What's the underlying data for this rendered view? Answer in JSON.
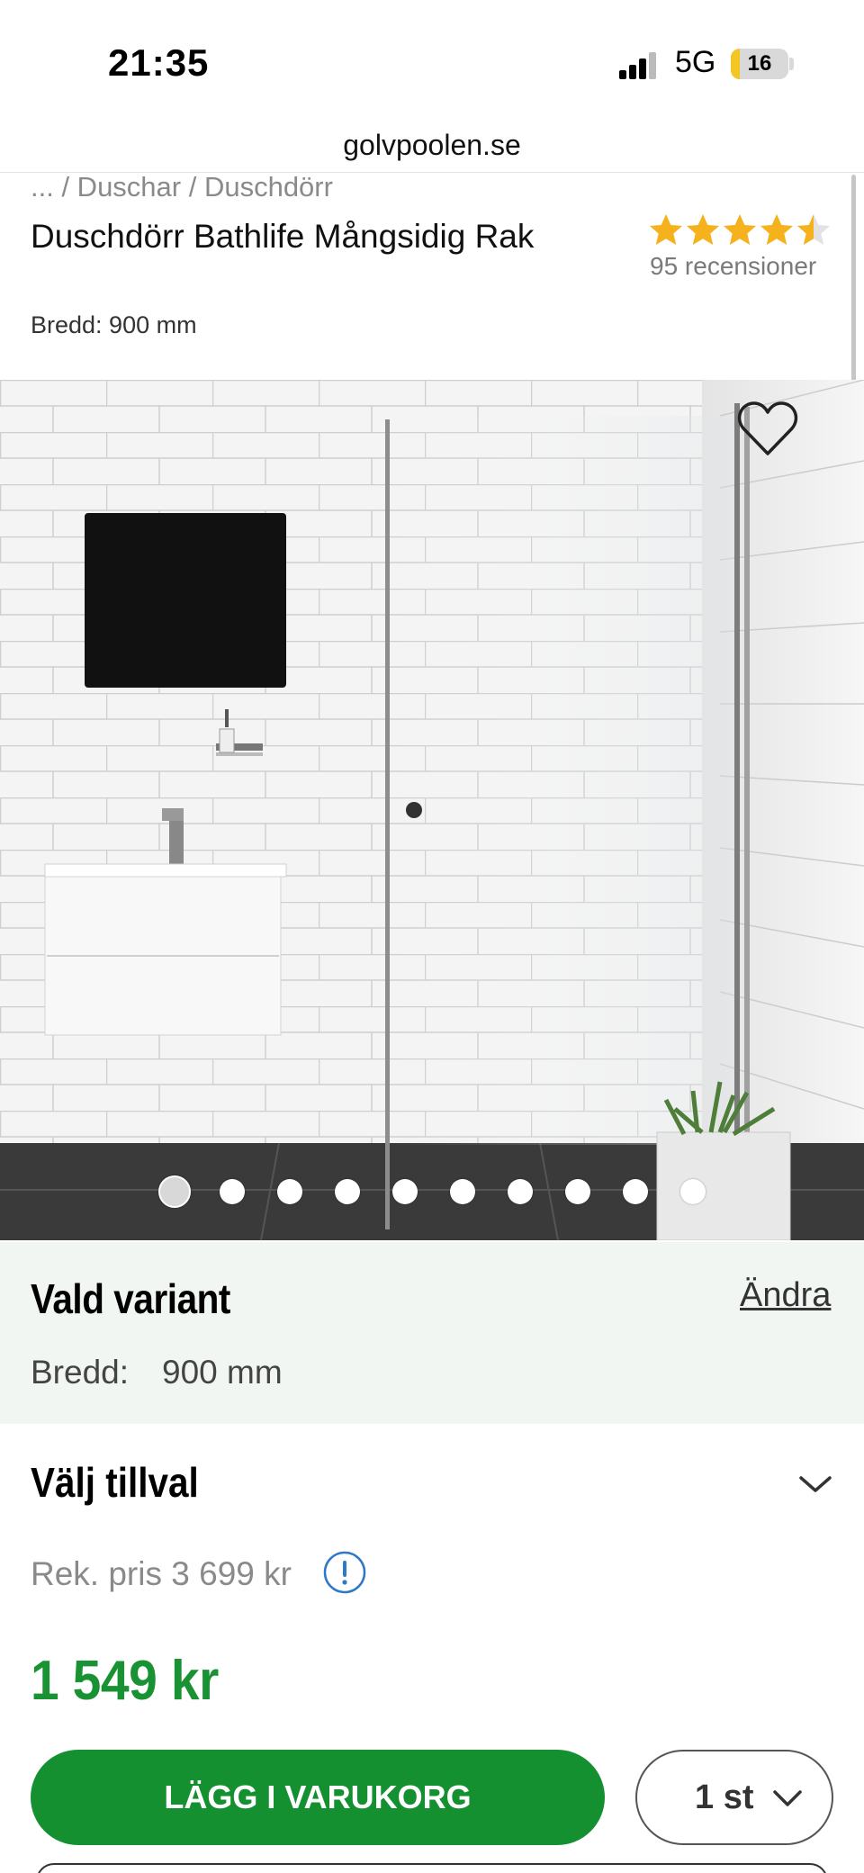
{
  "status_bar": {
    "time": "21:35",
    "network": "5G",
    "battery": "16",
    "battery_percent": 16
  },
  "browser": {
    "url": "golvpoolen.se"
  },
  "breadcrumb": "... / Duschar / Duschdörr",
  "product": {
    "title": "Duschdörr Bathlife Mångsidig Rak",
    "subtitle": "Bredd: 900 mm",
    "rating": 4.5,
    "rating_max": 5,
    "reviews": "95 recensioner",
    "image_count": 10,
    "active_image": 1
  },
  "variant": {
    "title": "Vald variant",
    "change_link": "Ändra",
    "label": "Bredd:",
    "value": "900 mm"
  },
  "options": {
    "title": "Välj tillval"
  },
  "pricing": {
    "recommended": "Rek. pris 3 699 kr",
    "price": "1 549 kr"
  },
  "cart": {
    "button_label": "LÄGG I VARUKORG",
    "quantity": "1 st"
  },
  "colors": {
    "accent_green": "#159030",
    "price_green": "#189233",
    "star": "#f5b21c",
    "variant_bg": "#f2f6f2"
  }
}
